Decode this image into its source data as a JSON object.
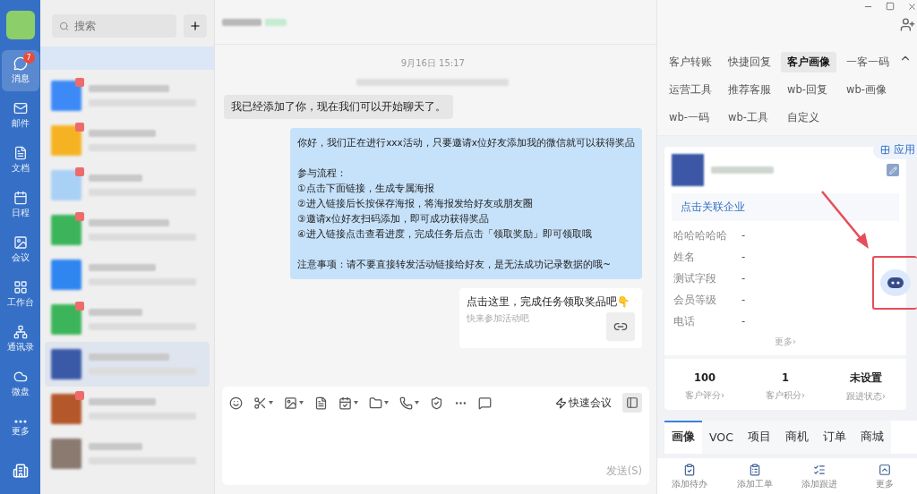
{
  "nav": {
    "items": [
      {
        "label": "消息",
        "badge": "7",
        "selected": true
      },
      {
        "label": "邮件",
        "selected": false
      },
      {
        "label": "文档",
        "selected": false
      },
      {
        "label": "日程",
        "selected": false
      },
      {
        "label": "会议",
        "selected": false
      },
      {
        "label": "工作台",
        "selected": false
      },
      {
        "label": "通讯录",
        "selected": false
      },
      {
        "label": "微盘",
        "selected": false
      },
      {
        "label": "更多",
        "selected": false
      }
    ]
  },
  "search": {
    "placeholder": "搜索"
  },
  "conversations": [
    {
      "color": "#3d8af7",
      "unread": true,
      "selected": false
    },
    {
      "color": "#f5b324",
      "unread": true,
      "selected": false
    },
    {
      "color": "#a9d0f5",
      "unread": true,
      "selected": false
    },
    {
      "color": "#3cb55a",
      "unread": true,
      "selected": false
    },
    {
      "color": "#2f86f0",
      "unread": false,
      "selected": false
    },
    {
      "color": "#3cb55a",
      "unread": true,
      "selected": false
    },
    {
      "color": "#3a5aa8",
      "unread": false,
      "selected": true
    },
    {
      "color": "#b4582c",
      "unread": true,
      "selected": false
    },
    {
      "color": "#8a7a70",
      "unread": false,
      "selected": false
    }
  ],
  "chat": {
    "timestamp": "9月16日 15:17",
    "messages": [
      {
        "kind": "incoming",
        "text": "我已经添加了你，现在我们可以开始聊天了。"
      },
      {
        "kind": "outgoing",
        "paragraphs": [
          [
            "你好，我们正在进行xxx活动，只要邀请x位好友添加我的微信就可以获得奖品"
          ],
          [
            "参与流程：",
            "①点击下面链接，生成专属海报",
            "②进入链接后长按保存海报，将海报发给好友或朋友圈",
            "③邀请x位好友扫码添加，即可成功获得奖品",
            "④进入链接点击查看进度，完成任务后点击「领取奖励」即可领取哦"
          ],
          [
            "注意事项：请不要直接转发活动链接给好友，是无法成功记录数据的哦~"
          ]
        ]
      },
      {
        "kind": "link",
        "title": "点击这里，完成任务领取奖品吧👇",
        "subtitle": "快来参加活动吧"
      }
    ],
    "quick_meeting": "快速会议",
    "send": "发送(S)"
  },
  "tools": {
    "tabs": [
      {
        "label": "客户转账",
        "selected": false
      },
      {
        "label": "快捷回复",
        "selected": false
      },
      {
        "label": "客户画像",
        "selected": true
      },
      {
        "label": "一客一码",
        "selected": false
      },
      {
        "label": "运营工具",
        "selected": false
      },
      {
        "label": "推荐客服",
        "selected": false
      },
      {
        "label": "wb-回复",
        "selected": false
      },
      {
        "label": "wb-画像",
        "selected": false
      },
      {
        "label": "wb-一码",
        "selected": false
      },
      {
        "label": "wb-工具",
        "selected": false
      },
      {
        "label": "自定义",
        "selected": false
      }
    ],
    "apps_button": "应用"
  },
  "profile": {
    "link": "点击关联企业",
    "fields": [
      {
        "label": "哈哈哈哈哈",
        "value": "-"
      },
      {
        "label": "姓名",
        "value": "-"
      },
      {
        "label": "测试字段",
        "value": "-"
      },
      {
        "label": "会员等级",
        "value": "-"
      },
      {
        "label": "电话",
        "value": "-"
      }
    ],
    "more": "更多›",
    "stats": [
      {
        "value": "100",
        "label": "客户评分›"
      },
      {
        "value": "1",
        "label": "客户积分›"
      },
      {
        "value": "未设置",
        "label": "跟进状态›"
      }
    ]
  },
  "detail_tabs": [
    {
      "label": "画像",
      "selected": true
    },
    {
      "label": "VOC",
      "selected": false
    },
    {
      "label": "项目",
      "selected": false
    },
    {
      "label": "商机",
      "selected": false
    },
    {
      "label": "订单",
      "selected": false
    },
    {
      "label": "商城",
      "selected": false
    }
  ],
  "actions": [
    {
      "label": "添加待办"
    },
    {
      "label": "添加工单"
    },
    {
      "label": "添加跟进"
    },
    {
      "label": "更多"
    }
  ]
}
